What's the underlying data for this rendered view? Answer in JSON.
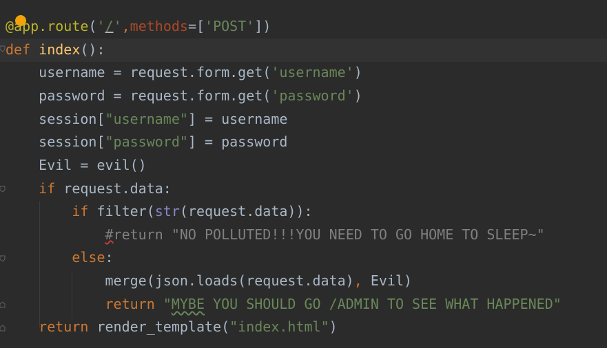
{
  "editor": {
    "lines": [
      [
        {
          "t": "@",
          "c": "t-dec"
        },
        {
          "t": "app.route",
          "c": "t-dec"
        },
        {
          "t": "(",
          "c": "t-punc"
        },
        {
          "t": "'",
          "c": "t-str"
        },
        {
          "t": "/",
          "c": "t-str t-under"
        },
        {
          "t": "'",
          "c": "t-str"
        },
        {
          "t": ",",
          "c": "t-kw"
        },
        {
          "t": "methods",
          "c": "t-param"
        },
        {
          "t": "=[",
          "c": "t-punc"
        },
        {
          "t": "'POST'",
          "c": "t-str"
        },
        {
          "t": "])",
          "c": "t-punc"
        }
      ],
      [
        {
          "t": "def ",
          "c": "t-kw"
        },
        {
          "t": "index",
          "c": "t-fn"
        },
        {
          "t": "():",
          "c": "t-punc"
        }
      ],
      [
        {
          "t": "    username = request.form.get(",
          "c": "t-id"
        },
        {
          "t": "'username'",
          "c": "t-str"
        },
        {
          "t": ")",
          "c": "t-punc"
        }
      ],
      [
        {
          "t": "    password = request.form.get(",
          "c": "t-id"
        },
        {
          "t": "'password'",
          "c": "t-str"
        },
        {
          "t": ")",
          "c": "t-punc"
        }
      ],
      [
        {
          "t": "    session[",
          "c": "t-id"
        },
        {
          "t": "\"username\"",
          "c": "t-str"
        },
        {
          "t": "] = username",
          "c": "t-id"
        }
      ],
      [
        {
          "t": "    session[",
          "c": "t-id"
        },
        {
          "t": "\"password\"",
          "c": "t-str"
        },
        {
          "t": "] = password",
          "c": "t-id"
        }
      ],
      [
        {
          "t": "    Evil = evil()",
          "c": "t-id"
        }
      ],
      [
        {
          "t": "    ",
          "c": "t-id"
        },
        {
          "t": "if ",
          "c": "t-kw"
        },
        {
          "t": "request.data:",
          "c": "t-id"
        }
      ],
      [
        {
          "t": "        ",
          "c": "t-id"
        },
        {
          "t": "if ",
          "c": "t-kw"
        },
        {
          "t": "filter(",
          "c": "t-id"
        },
        {
          "t": "str",
          "c": "t-builtin"
        },
        {
          "t": "(request.data)):",
          "c": "t-id"
        }
      ],
      [
        {
          "t": "            ",
          "c": "t-id"
        },
        {
          "t": "#",
          "c": "t-com squiggle-red"
        },
        {
          "t": "return \"NO POLLUTED!!!YOU NEED TO GO HOME TO SLEEP~\"",
          "c": "t-com"
        }
      ],
      [
        {
          "t": "        ",
          "c": "t-id"
        },
        {
          "t": "else",
          "c": "t-kw"
        },
        {
          "t": ":",
          "c": "t-punc"
        }
      ],
      [
        {
          "t": "            merge(json.loads(request.data)",
          "c": "t-id"
        },
        {
          "t": ",",
          "c": "t-kw"
        },
        {
          "t": " Evil)",
          "c": "t-id"
        }
      ],
      [
        {
          "t": "            ",
          "c": "t-id"
        },
        {
          "t": "return ",
          "c": "t-kw"
        },
        {
          "t": "\"",
          "c": "t-str"
        },
        {
          "t": "MYBE",
          "c": "t-str squiggle-green"
        },
        {
          "t": " YOU SHOULD GO /ADMIN TO SEE WHAT HAPPENED\"",
          "c": "t-str"
        }
      ],
      [
        {
          "t": "    ",
          "c": "t-id"
        },
        {
          "t": "return ",
          "c": "t-kw"
        },
        {
          "t": "render_template(",
          "c": "t-id"
        },
        {
          "t": "\"index.html\"",
          "c": "t-str"
        },
        {
          "t": ")",
          "c": "t-punc"
        }
      ]
    ]
  },
  "colors": {
    "background": "#2b2b2b",
    "current_line": "#323232",
    "keyword": "#cc7832",
    "string": "#6a8759",
    "function": "#ffc66d",
    "decorator": "#bbb529",
    "comment": "#808080",
    "breakpoint": "#f0a30a"
  },
  "icons": {
    "breakpoint": "breakpoint-dot-icon",
    "fold": "fold-marker-icon"
  }
}
